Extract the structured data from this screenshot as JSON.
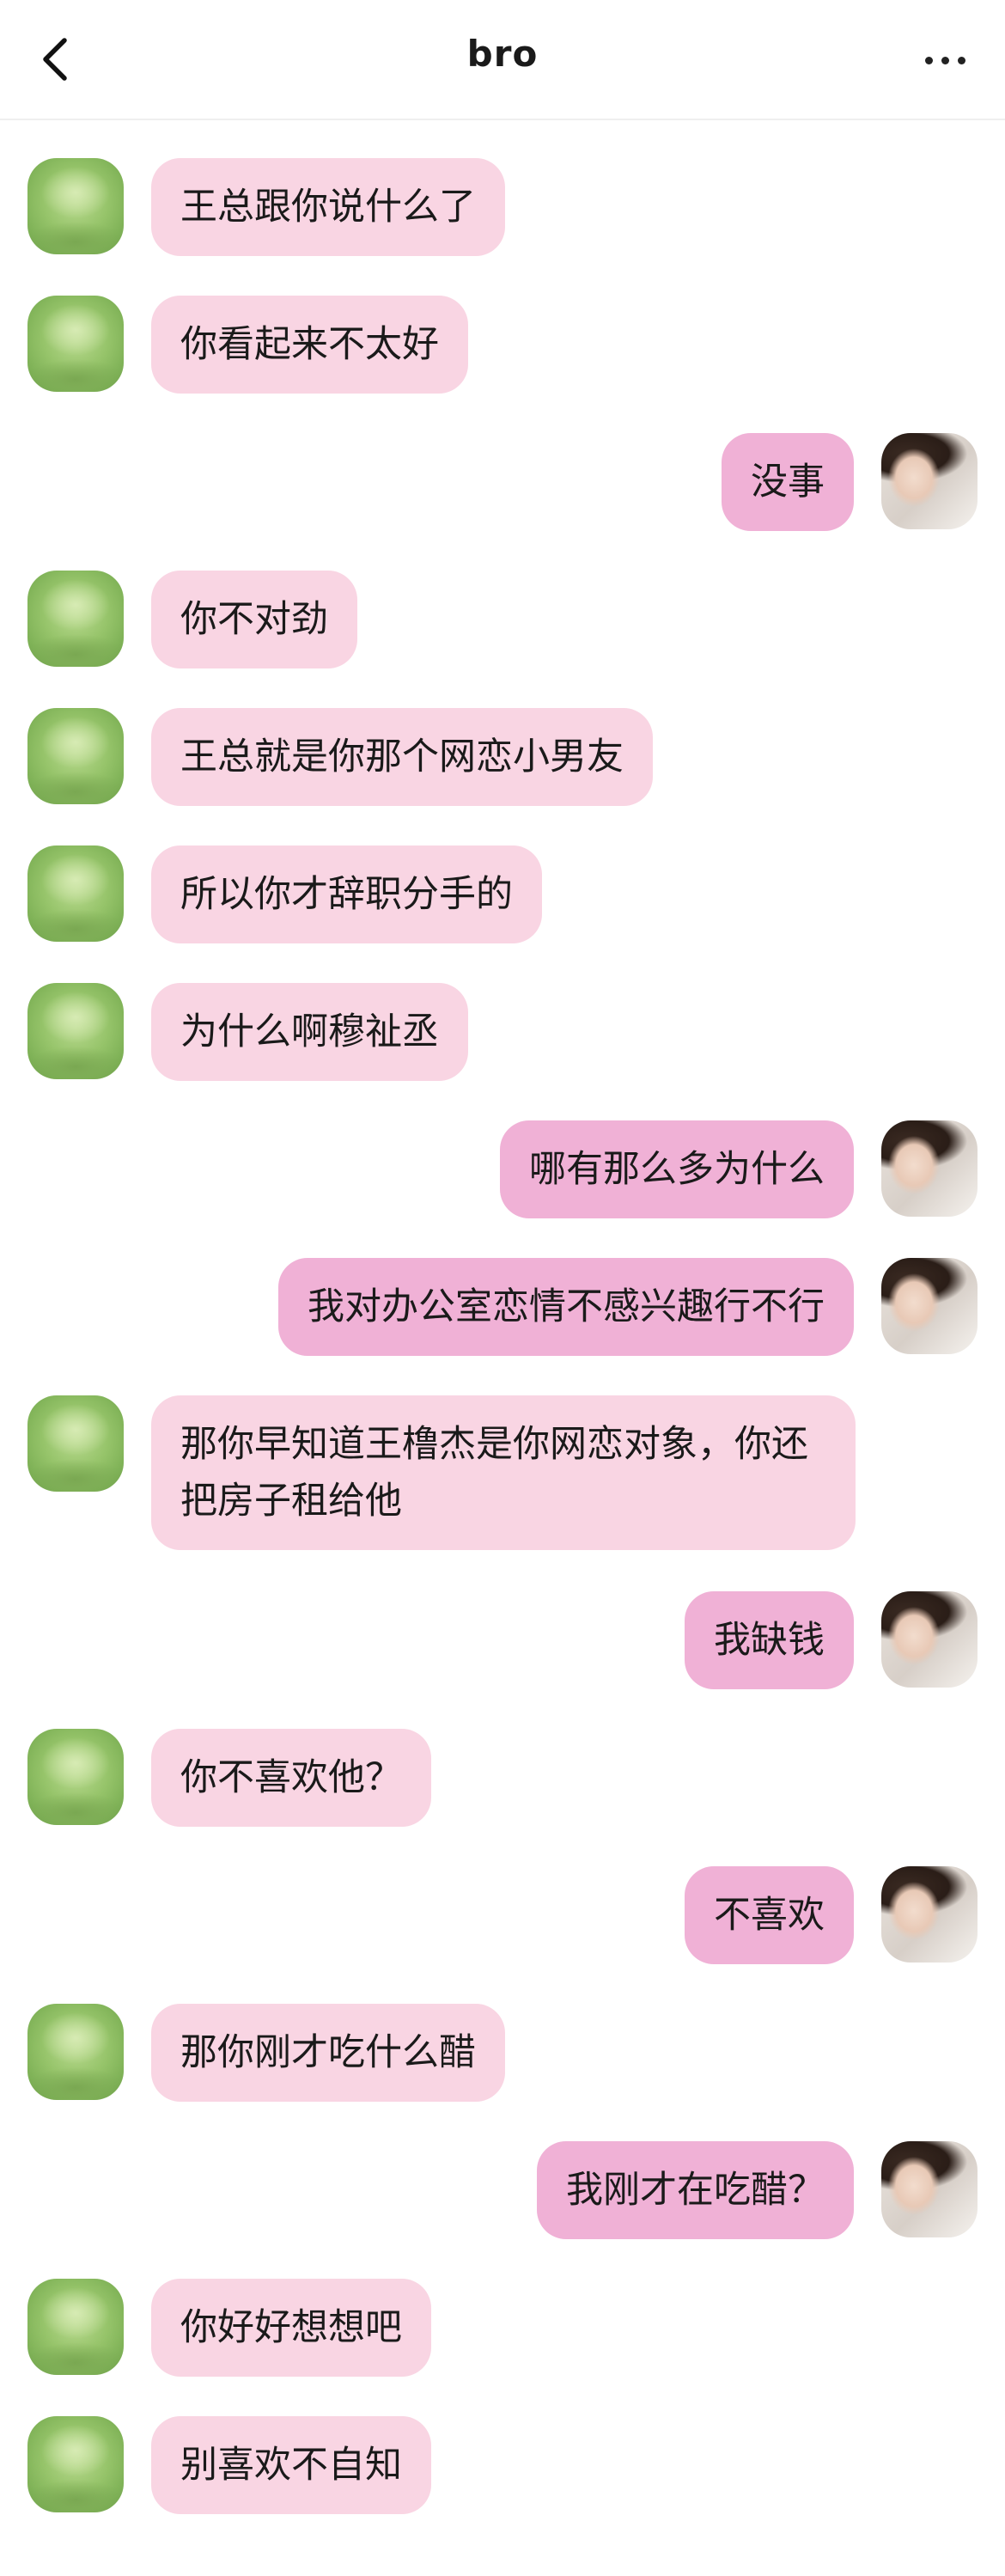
{
  "header": {
    "title": "bro",
    "back_icon": "chevron-left-icon",
    "more_icon": "more-horizontal-icon"
  },
  "colors": {
    "incoming_bubble": "#f9d5e3",
    "outgoing_bubble": "#f0b1d6"
  },
  "messages": [
    {
      "side": "in",
      "text": "王总跟你说什么了"
    },
    {
      "side": "in",
      "text": "你看起来不太好"
    },
    {
      "side": "out",
      "text": "没事"
    },
    {
      "side": "in",
      "text": "你不对劲"
    },
    {
      "side": "in",
      "text": "王总就是你那个网恋小男友"
    },
    {
      "side": "in",
      "text": "所以你才辞职分手的"
    },
    {
      "side": "in",
      "text": "为什么啊穆祉丞"
    },
    {
      "side": "out",
      "text": "哪有那么多为什么"
    },
    {
      "side": "out",
      "text": "我对办公室恋情不感兴趣行不行"
    },
    {
      "side": "in",
      "text": "那你早知道王橹杰是你网恋对象，你还把房子租给他"
    },
    {
      "side": "out",
      "text": "我缺钱"
    },
    {
      "side": "in",
      "text": "你不喜欢他？"
    },
    {
      "side": "out",
      "text": "不喜欢"
    },
    {
      "side": "in",
      "text": "那你刚才吃什么醋"
    },
    {
      "side": "out",
      "text": "我刚才在吃醋？"
    },
    {
      "side": "in",
      "text": "你好好想想吧"
    },
    {
      "side": "in",
      "text": "别喜欢不自知"
    }
  ]
}
